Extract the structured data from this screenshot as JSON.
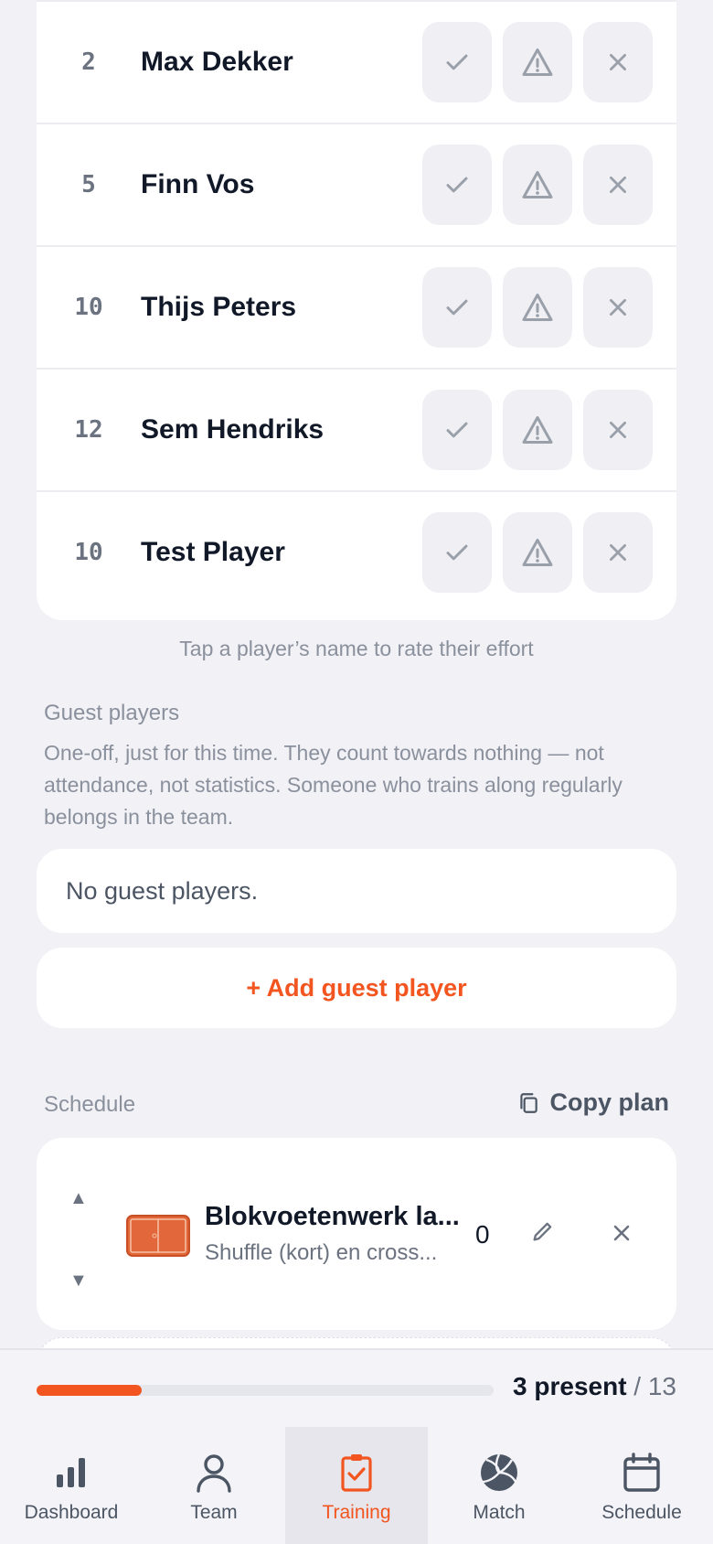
{
  "players": [
    {
      "number": "2",
      "name": "Max Dekker"
    },
    {
      "number": "5",
      "name": "Finn Vos"
    },
    {
      "number": "10",
      "name": "Thijs Peters"
    },
    {
      "number": "12",
      "name": "Sem Hendriks"
    },
    {
      "number": "10",
      "name": "Test Player"
    }
  ],
  "hint": "Tap a player’s name to rate their effort",
  "guests": {
    "label": "Guest players",
    "description": "One-off, just for this time. They count towards nothing — not attendance, not statistics. Someone who trains along regularly belongs in the team.",
    "empty_text": "No guest players.",
    "add_label": "+ Add guest player"
  },
  "schedule": {
    "label": "Schedule",
    "copy_label": "Copy plan",
    "exercise": {
      "title": "Blokvoetenwerk la...",
      "subtitle": "Shuffle (kort) en cross...",
      "count": "0"
    }
  },
  "attendance": {
    "present_label": "3 present",
    "total_label": "/ 13",
    "present": 3,
    "total": 13
  },
  "nav": [
    {
      "label": "Dashboard",
      "icon": "bar-chart-icon"
    },
    {
      "label": "Team",
      "icon": "person-icon"
    },
    {
      "label": "Training",
      "icon": "clipboard-check-icon"
    },
    {
      "label": "Match",
      "icon": "volleyball-icon"
    },
    {
      "label": "Schedule",
      "icon": "calendar-icon"
    }
  ],
  "colors": {
    "accent": "#f2551f",
    "background": "#f1f1f6",
    "card": "#ffffff"
  }
}
